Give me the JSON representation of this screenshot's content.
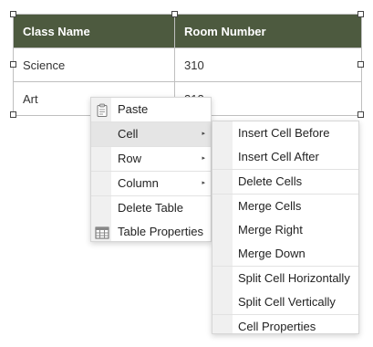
{
  "table": {
    "headers": [
      "Class Name",
      "Room Number"
    ],
    "rows": [
      [
        "Science",
        "310"
      ],
      [
        "Art",
        "312"
      ]
    ],
    "header_color": "#4d5a3f"
  },
  "context_menu": {
    "items": [
      {
        "label": "Paste",
        "icon": "paste-icon"
      },
      {
        "label": "Cell",
        "has_submenu": true
      },
      {
        "label": "Row",
        "has_submenu": true
      },
      {
        "label": "Column",
        "has_submenu": true
      },
      {
        "label": "Delete Table"
      },
      {
        "label": "Table Properties",
        "icon": "table-icon"
      }
    ],
    "submenu_arrow": "▸"
  },
  "cell_submenu": {
    "items": [
      "Insert Cell Before",
      "Insert Cell After",
      "Delete Cells",
      "Merge Cells",
      "Merge Right",
      "Merge Down",
      "Split Cell Horizontally",
      "Split Cell Vertically",
      "Cell Properties"
    ]
  }
}
